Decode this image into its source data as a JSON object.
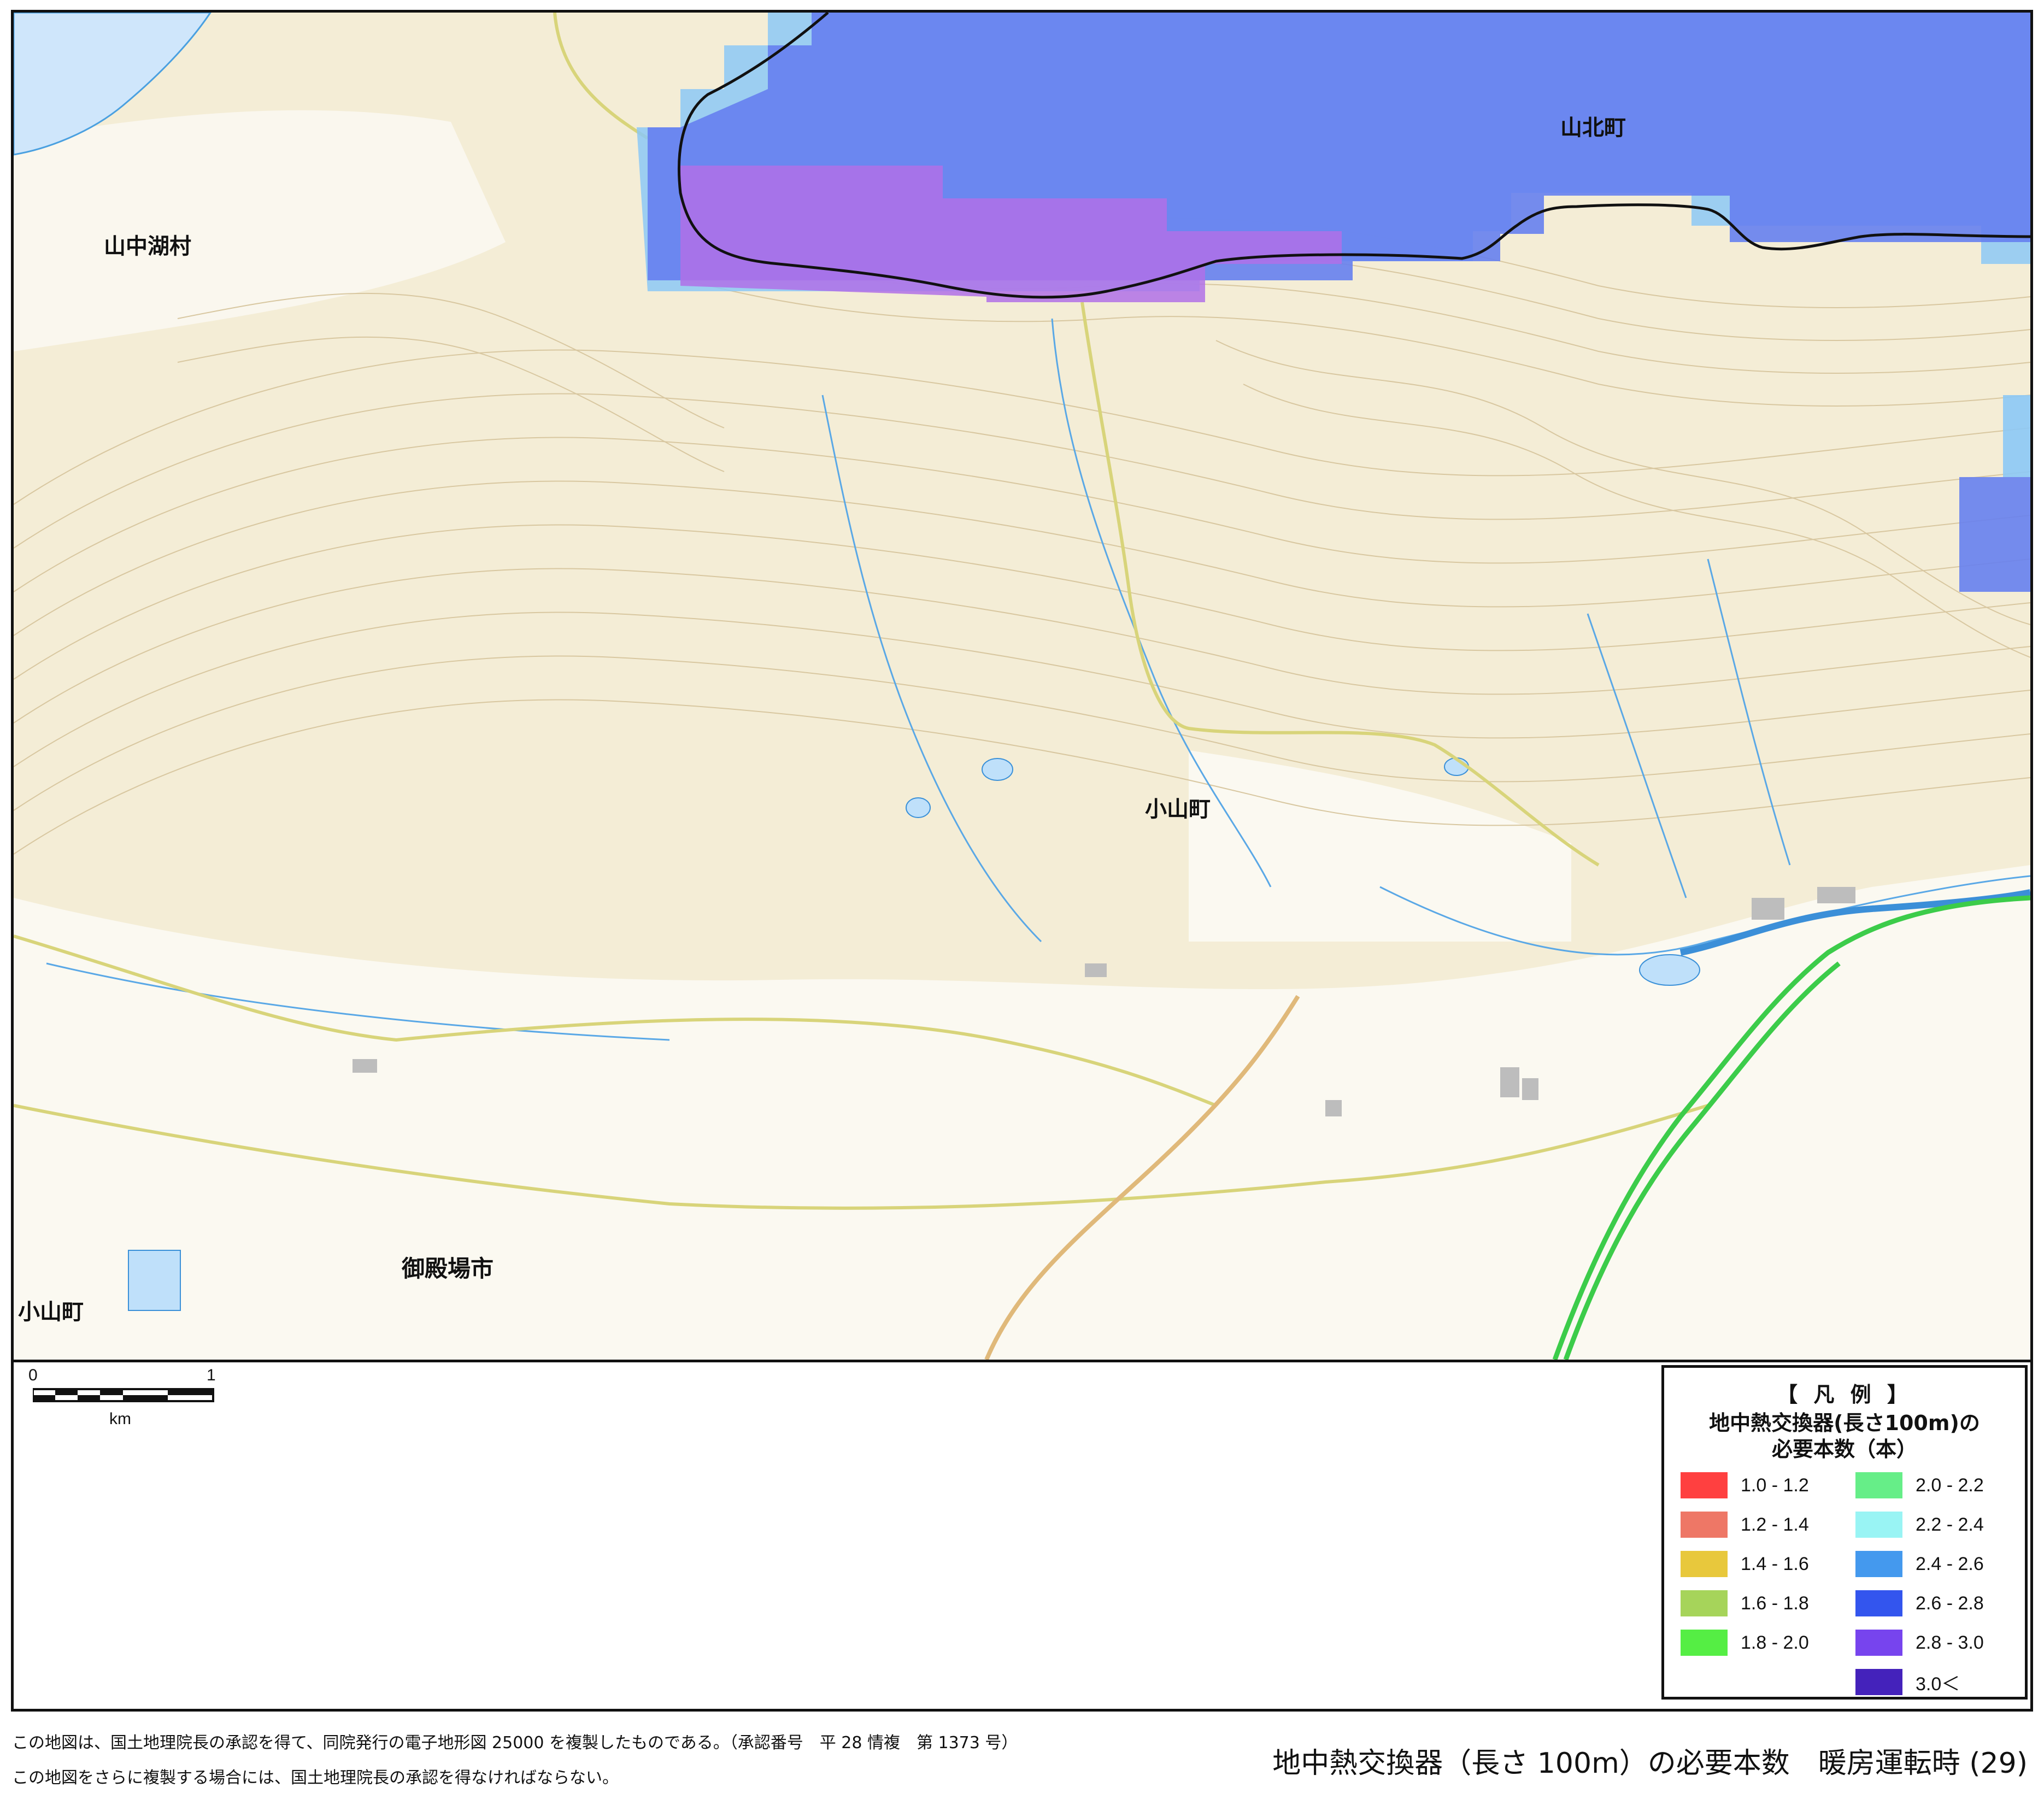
{
  "map": {
    "place_names": [
      {
        "id": "yamanakako",
        "text": "山中湖村"
      },
      {
        "id": "yamakita",
        "text": "山北町"
      },
      {
        "id": "oyama-center",
        "text": "小山町"
      },
      {
        "id": "gotemba",
        "text": "御殿場市"
      },
      {
        "id": "oyama-sw",
        "text": "小山町"
      }
    ],
    "scale": {
      "start": "0",
      "end": "1",
      "unit": "km"
    }
  },
  "legend": {
    "title": "【 凡 例 】",
    "subtitle_line1": "地中熱交換器(長さ100m)の",
    "subtitle_line2": "必要本数（本）",
    "items": [
      {
        "label": "1.0 - 1.2",
        "color": "#ff4040"
      },
      {
        "label": "1.2 - 1.4",
        "color": "#ee7766"
      },
      {
        "label": "1.4 - 1.6",
        "color": "#e8c83c"
      },
      {
        "label": "1.6 - 1.8",
        "color": "#a6d45a"
      },
      {
        "label": "1.8 - 2.0",
        "color": "#55ee44"
      },
      {
        "label": "2.0 - 2.2",
        "color": "#66ee88"
      },
      {
        "label": "2.2 - 2.4",
        "color": "#99f4f4"
      },
      {
        "label": "2.4 - 2.6",
        "color": "#4499ee"
      },
      {
        "label": "2.6 - 2.8",
        "color": "#3355ee"
      },
      {
        "label": "2.8 - 3.0",
        "color": "#7744ee"
      },
      {
        "label": "3.0＜",
        "color": "#4422bb"
      }
    ]
  },
  "footer": {
    "note1": "この地図は、国土地理院長の承認を得て、同院発行の電子地形図 25000 を複製したものである。（承認番号　平 28 情複　第 1373 号）",
    "note2": "この地図をさらに複製する場合には、国土地理院長の承認を得なければならない。",
    "title": "地中熱交換器（長さ 100m）の必要本数　暖房運転時 (29)"
  },
  "colors": {
    "terrain": "#f3ecd2",
    "lowland": "#fbfaf3",
    "water": "#cfe6fb",
    "overlay_blue": "#6680f0",
    "overlay_purple": "#b070e8",
    "overlay_light": "#8cc8f6"
  }
}
